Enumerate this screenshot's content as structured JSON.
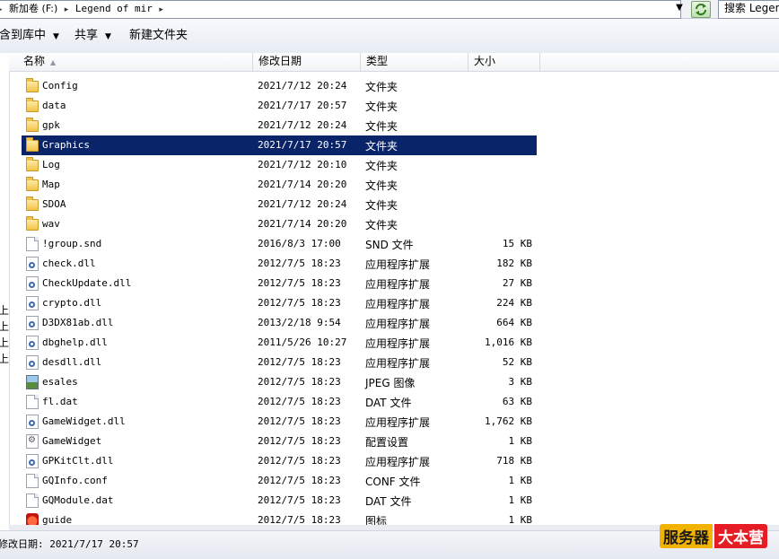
{
  "address": {
    "crumbs": [
      "新加卷 (F:)",
      "Legend of mir"
    ],
    "search_placeholder": "搜索 Legend of mir"
  },
  "toolbar": {
    "include_library": "包含到库中",
    "share": "共享",
    "new_folder": "新建文件夹"
  },
  "nav_fragments": [
    "上",
    "上",
    "上",
    "上"
  ],
  "columns": {
    "name": "名称",
    "modified": "修改日期",
    "type": "类型",
    "size": "大小"
  },
  "files": [
    {
      "name": "Config",
      "modified": "2021/7/12 20:24",
      "type": "文件夹",
      "size": "",
      "icon": "folder-icon"
    },
    {
      "name": "data",
      "modified": "2021/7/17 20:57",
      "type": "文件夹",
      "size": "",
      "icon": "folder-icon"
    },
    {
      "name": "gpk",
      "modified": "2021/7/12 20:24",
      "type": "文件夹",
      "size": "",
      "icon": "folder-icon"
    },
    {
      "name": "Graphics",
      "modified": "2021/7/17 20:57",
      "type": "文件夹",
      "size": "",
      "icon": "folder-icon",
      "selected": true
    },
    {
      "name": "Log",
      "modified": "2021/7/12 20:10",
      "type": "文件夹",
      "size": "",
      "icon": "folder-icon"
    },
    {
      "name": "Map",
      "modified": "2021/7/14 20:20",
      "type": "文件夹",
      "size": "",
      "icon": "folder-icon"
    },
    {
      "name": "SDOA",
      "modified": "2021/7/12 20:24",
      "type": "文件夹",
      "size": "",
      "icon": "folder-icon"
    },
    {
      "name": "wav",
      "modified": "2021/7/14 20:20",
      "type": "文件夹",
      "size": "",
      "icon": "folder-icon"
    },
    {
      "name": "!group.snd",
      "modified": "2016/8/3 17:00",
      "type": "SND 文件",
      "size": "15 KB",
      "icon": "document-icon"
    },
    {
      "name": "check.dll",
      "modified": "2012/7/5 18:23",
      "type": "应用程序扩展",
      "size": "182 KB",
      "icon": "dll-icon"
    },
    {
      "name": "CheckUpdate.dll",
      "modified": "2012/7/5 18:23",
      "type": "应用程序扩展",
      "size": "27 KB",
      "icon": "dll-icon"
    },
    {
      "name": "crypto.dll",
      "modified": "2012/7/5 18:23",
      "type": "应用程序扩展",
      "size": "224 KB",
      "icon": "dll-icon"
    },
    {
      "name": "D3DX81ab.dll",
      "modified": "2013/2/18 9:54",
      "type": "应用程序扩展",
      "size": "664 KB",
      "icon": "dll-icon"
    },
    {
      "name": "dbghelp.dll",
      "modified": "2011/5/26 10:27",
      "type": "应用程序扩展",
      "size": "1,016 KB",
      "icon": "dll-icon"
    },
    {
      "name": "desdll.dll",
      "modified": "2012/7/5 18:23",
      "type": "应用程序扩展",
      "size": "52 KB",
      "icon": "dll-icon"
    },
    {
      "name": "esales",
      "modified": "2012/7/5 18:23",
      "type": "JPEG 图像",
      "size": "3 KB",
      "icon": "image-icon"
    },
    {
      "name": "fl.dat",
      "modified": "2012/7/5 18:23",
      "type": "DAT 文件",
      "size": "63 KB",
      "icon": "document-icon"
    },
    {
      "name": "GameWidget.dll",
      "modified": "2012/7/5 18:23",
      "type": "应用程序扩展",
      "size": "1,762 KB",
      "icon": "dll-icon"
    },
    {
      "name": "GameWidget",
      "modified": "2012/7/5 18:23",
      "type": "配置设置",
      "size": "1 KB",
      "icon": "config-icon"
    },
    {
      "name": "GPKitClt.dll",
      "modified": "2012/7/5 18:23",
      "type": "应用程序扩展",
      "size": "718 KB",
      "icon": "dll-icon"
    },
    {
      "name": "GQInfo.conf",
      "modified": "2012/7/5 18:23",
      "type": "CONF 文件",
      "size": "1 KB",
      "icon": "document-icon"
    },
    {
      "name": "GQModule.dat",
      "modified": "2012/7/5 18:23",
      "type": "DAT 文件",
      "size": "1 KB",
      "icon": "document-icon"
    },
    {
      "name": "guide",
      "modified": "2012/7/5 18:23",
      "type": "图标",
      "size": "1 KB",
      "icon": "app-icon"
    }
  ],
  "status": {
    "text": "修改日期: 2021/7/17 20:57"
  },
  "watermark": {
    "part1": "服务器",
    "part2": "大本营"
  }
}
